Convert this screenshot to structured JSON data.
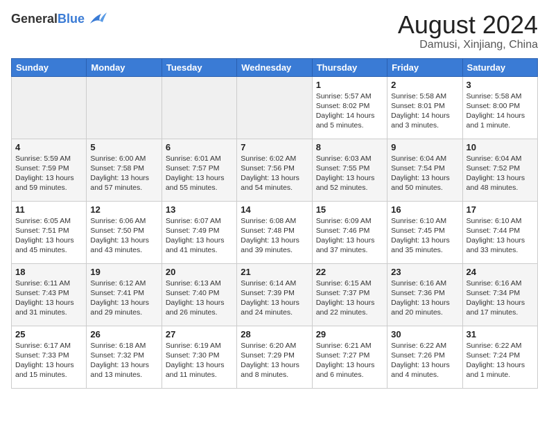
{
  "header": {
    "logo_general": "General",
    "logo_blue": "Blue",
    "main_title": "August 2024",
    "subtitle": "Damusi, Xinjiang, China"
  },
  "weekdays": [
    "Sunday",
    "Monday",
    "Tuesday",
    "Wednesday",
    "Thursday",
    "Friday",
    "Saturday"
  ],
  "weeks": [
    [
      {
        "day": "",
        "sunrise": "",
        "sunset": "",
        "daylight": ""
      },
      {
        "day": "",
        "sunrise": "",
        "sunset": "",
        "daylight": ""
      },
      {
        "day": "",
        "sunrise": "",
        "sunset": "",
        "daylight": ""
      },
      {
        "day": "",
        "sunrise": "",
        "sunset": "",
        "daylight": ""
      },
      {
        "day": "1",
        "sunrise": "Sunrise: 5:57 AM",
        "sunset": "Sunset: 8:02 PM",
        "daylight": "Daylight: 14 hours and 5 minutes."
      },
      {
        "day": "2",
        "sunrise": "Sunrise: 5:58 AM",
        "sunset": "Sunset: 8:01 PM",
        "daylight": "Daylight: 14 hours and 3 minutes."
      },
      {
        "day": "3",
        "sunrise": "Sunrise: 5:58 AM",
        "sunset": "Sunset: 8:00 PM",
        "daylight": "Daylight: 14 hours and 1 minute."
      }
    ],
    [
      {
        "day": "4",
        "sunrise": "Sunrise: 5:59 AM",
        "sunset": "Sunset: 7:59 PM",
        "daylight": "Daylight: 13 hours and 59 minutes."
      },
      {
        "day": "5",
        "sunrise": "Sunrise: 6:00 AM",
        "sunset": "Sunset: 7:58 PM",
        "daylight": "Daylight: 13 hours and 57 minutes."
      },
      {
        "day": "6",
        "sunrise": "Sunrise: 6:01 AM",
        "sunset": "Sunset: 7:57 PM",
        "daylight": "Daylight: 13 hours and 55 minutes."
      },
      {
        "day": "7",
        "sunrise": "Sunrise: 6:02 AM",
        "sunset": "Sunset: 7:56 PM",
        "daylight": "Daylight: 13 hours and 54 minutes."
      },
      {
        "day": "8",
        "sunrise": "Sunrise: 6:03 AM",
        "sunset": "Sunset: 7:55 PM",
        "daylight": "Daylight: 13 hours and 52 minutes."
      },
      {
        "day": "9",
        "sunrise": "Sunrise: 6:04 AM",
        "sunset": "Sunset: 7:54 PM",
        "daylight": "Daylight: 13 hours and 50 minutes."
      },
      {
        "day": "10",
        "sunrise": "Sunrise: 6:04 AM",
        "sunset": "Sunset: 7:52 PM",
        "daylight": "Daylight: 13 hours and 48 minutes."
      }
    ],
    [
      {
        "day": "11",
        "sunrise": "Sunrise: 6:05 AM",
        "sunset": "Sunset: 7:51 PM",
        "daylight": "Daylight: 13 hours and 45 minutes."
      },
      {
        "day": "12",
        "sunrise": "Sunrise: 6:06 AM",
        "sunset": "Sunset: 7:50 PM",
        "daylight": "Daylight: 13 hours and 43 minutes."
      },
      {
        "day": "13",
        "sunrise": "Sunrise: 6:07 AM",
        "sunset": "Sunset: 7:49 PM",
        "daylight": "Daylight: 13 hours and 41 minutes."
      },
      {
        "day": "14",
        "sunrise": "Sunrise: 6:08 AM",
        "sunset": "Sunset: 7:48 PM",
        "daylight": "Daylight: 13 hours and 39 minutes."
      },
      {
        "day": "15",
        "sunrise": "Sunrise: 6:09 AM",
        "sunset": "Sunset: 7:46 PM",
        "daylight": "Daylight: 13 hours and 37 minutes."
      },
      {
        "day": "16",
        "sunrise": "Sunrise: 6:10 AM",
        "sunset": "Sunset: 7:45 PM",
        "daylight": "Daylight: 13 hours and 35 minutes."
      },
      {
        "day": "17",
        "sunrise": "Sunrise: 6:10 AM",
        "sunset": "Sunset: 7:44 PM",
        "daylight": "Daylight: 13 hours and 33 minutes."
      }
    ],
    [
      {
        "day": "18",
        "sunrise": "Sunrise: 6:11 AM",
        "sunset": "Sunset: 7:43 PM",
        "daylight": "Daylight: 13 hours and 31 minutes."
      },
      {
        "day": "19",
        "sunrise": "Sunrise: 6:12 AM",
        "sunset": "Sunset: 7:41 PM",
        "daylight": "Daylight: 13 hours and 29 minutes."
      },
      {
        "day": "20",
        "sunrise": "Sunrise: 6:13 AM",
        "sunset": "Sunset: 7:40 PM",
        "daylight": "Daylight: 13 hours and 26 minutes."
      },
      {
        "day": "21",
        "sunrise": "Sunrise: 6:14 AM",
        "sunset": "Sunset: 7:39 PM",
        "daylight": "Daylight: 13 hours and 24 minutes."
      },
      {
        "day": "22",
        "sunrise": "Sunrise: 6:15 AM",
        "sunset": "Sunset: 7:37 PM",
        "daylight": "Daylight: 13 hours and 22 minutes."
      },
      {
        "day": "23",
        "sunrise": "Sunrise: 6:16 AM",
        "sunset": "Sunset: 7:36 PM",
        "daylight": "Daylight: 13 hours and 20 minutes."
      },
      {
        "day": "24",
        "sunrise": "Sunrise: 6:16 AM",
        "sunset": "Sunset: 7:34 PM",
        "daylight": "Daylight: 13 hours and 17 minutes."
      }
    ],
    [
      {
        "day": "25",
        "sunrise": "Sunrise: 6:17 AM",
        "sunset": "Sunset: 7:33 PM",
        "daylight": "Daylight: 13 hours and 15 minutes."
      },
      {
        "day": "26",
        "sunrise": "Sunrise: 6:18 AM",
        "sunset": "Sunset: 7:32 PM",
        "daylight": "Daylight: 13 hours and 13 minutes."
      },
      {
        "day": "27",
        "sunrise": "Sunrise: 6:19 AM",
        "sunset": "Sunset: 7:30 PM",
        "daylight": "Daylight: 13 hours and 11 minutes."
      },
      {
        "day": "28",
        "sunrise": "Sunrise: 6:20 AM",
        "sunset": "Sunset: 7:29 PM",
        "daylight": "Daylight: 13 hours and 8 minutes."
      },
      {
        "day": "29",
        "sunrise": "Sunrise: 6:21 AM",
        "sunset": "Sunset: 7:27 PM",
        "daylight": "Daylight: 13 hours and 6 minutes."
      },
      {
        "day": "30",
        "sunrise": "Sunrise: 6:22 AM",
        "sunset": "Sunset: 7:26 PM",
        "daylight": "Daylight: 13 hours and 4 minutes."
      },
      {
        "day": "31",
        "sunrise": "Sunrise: 6:22 AM",
        "sunset": "Sunset: 7:24 PM",
        "daylight": "Daylight: 13 hours and 1 minute."
      }
    ]
  ]
}
